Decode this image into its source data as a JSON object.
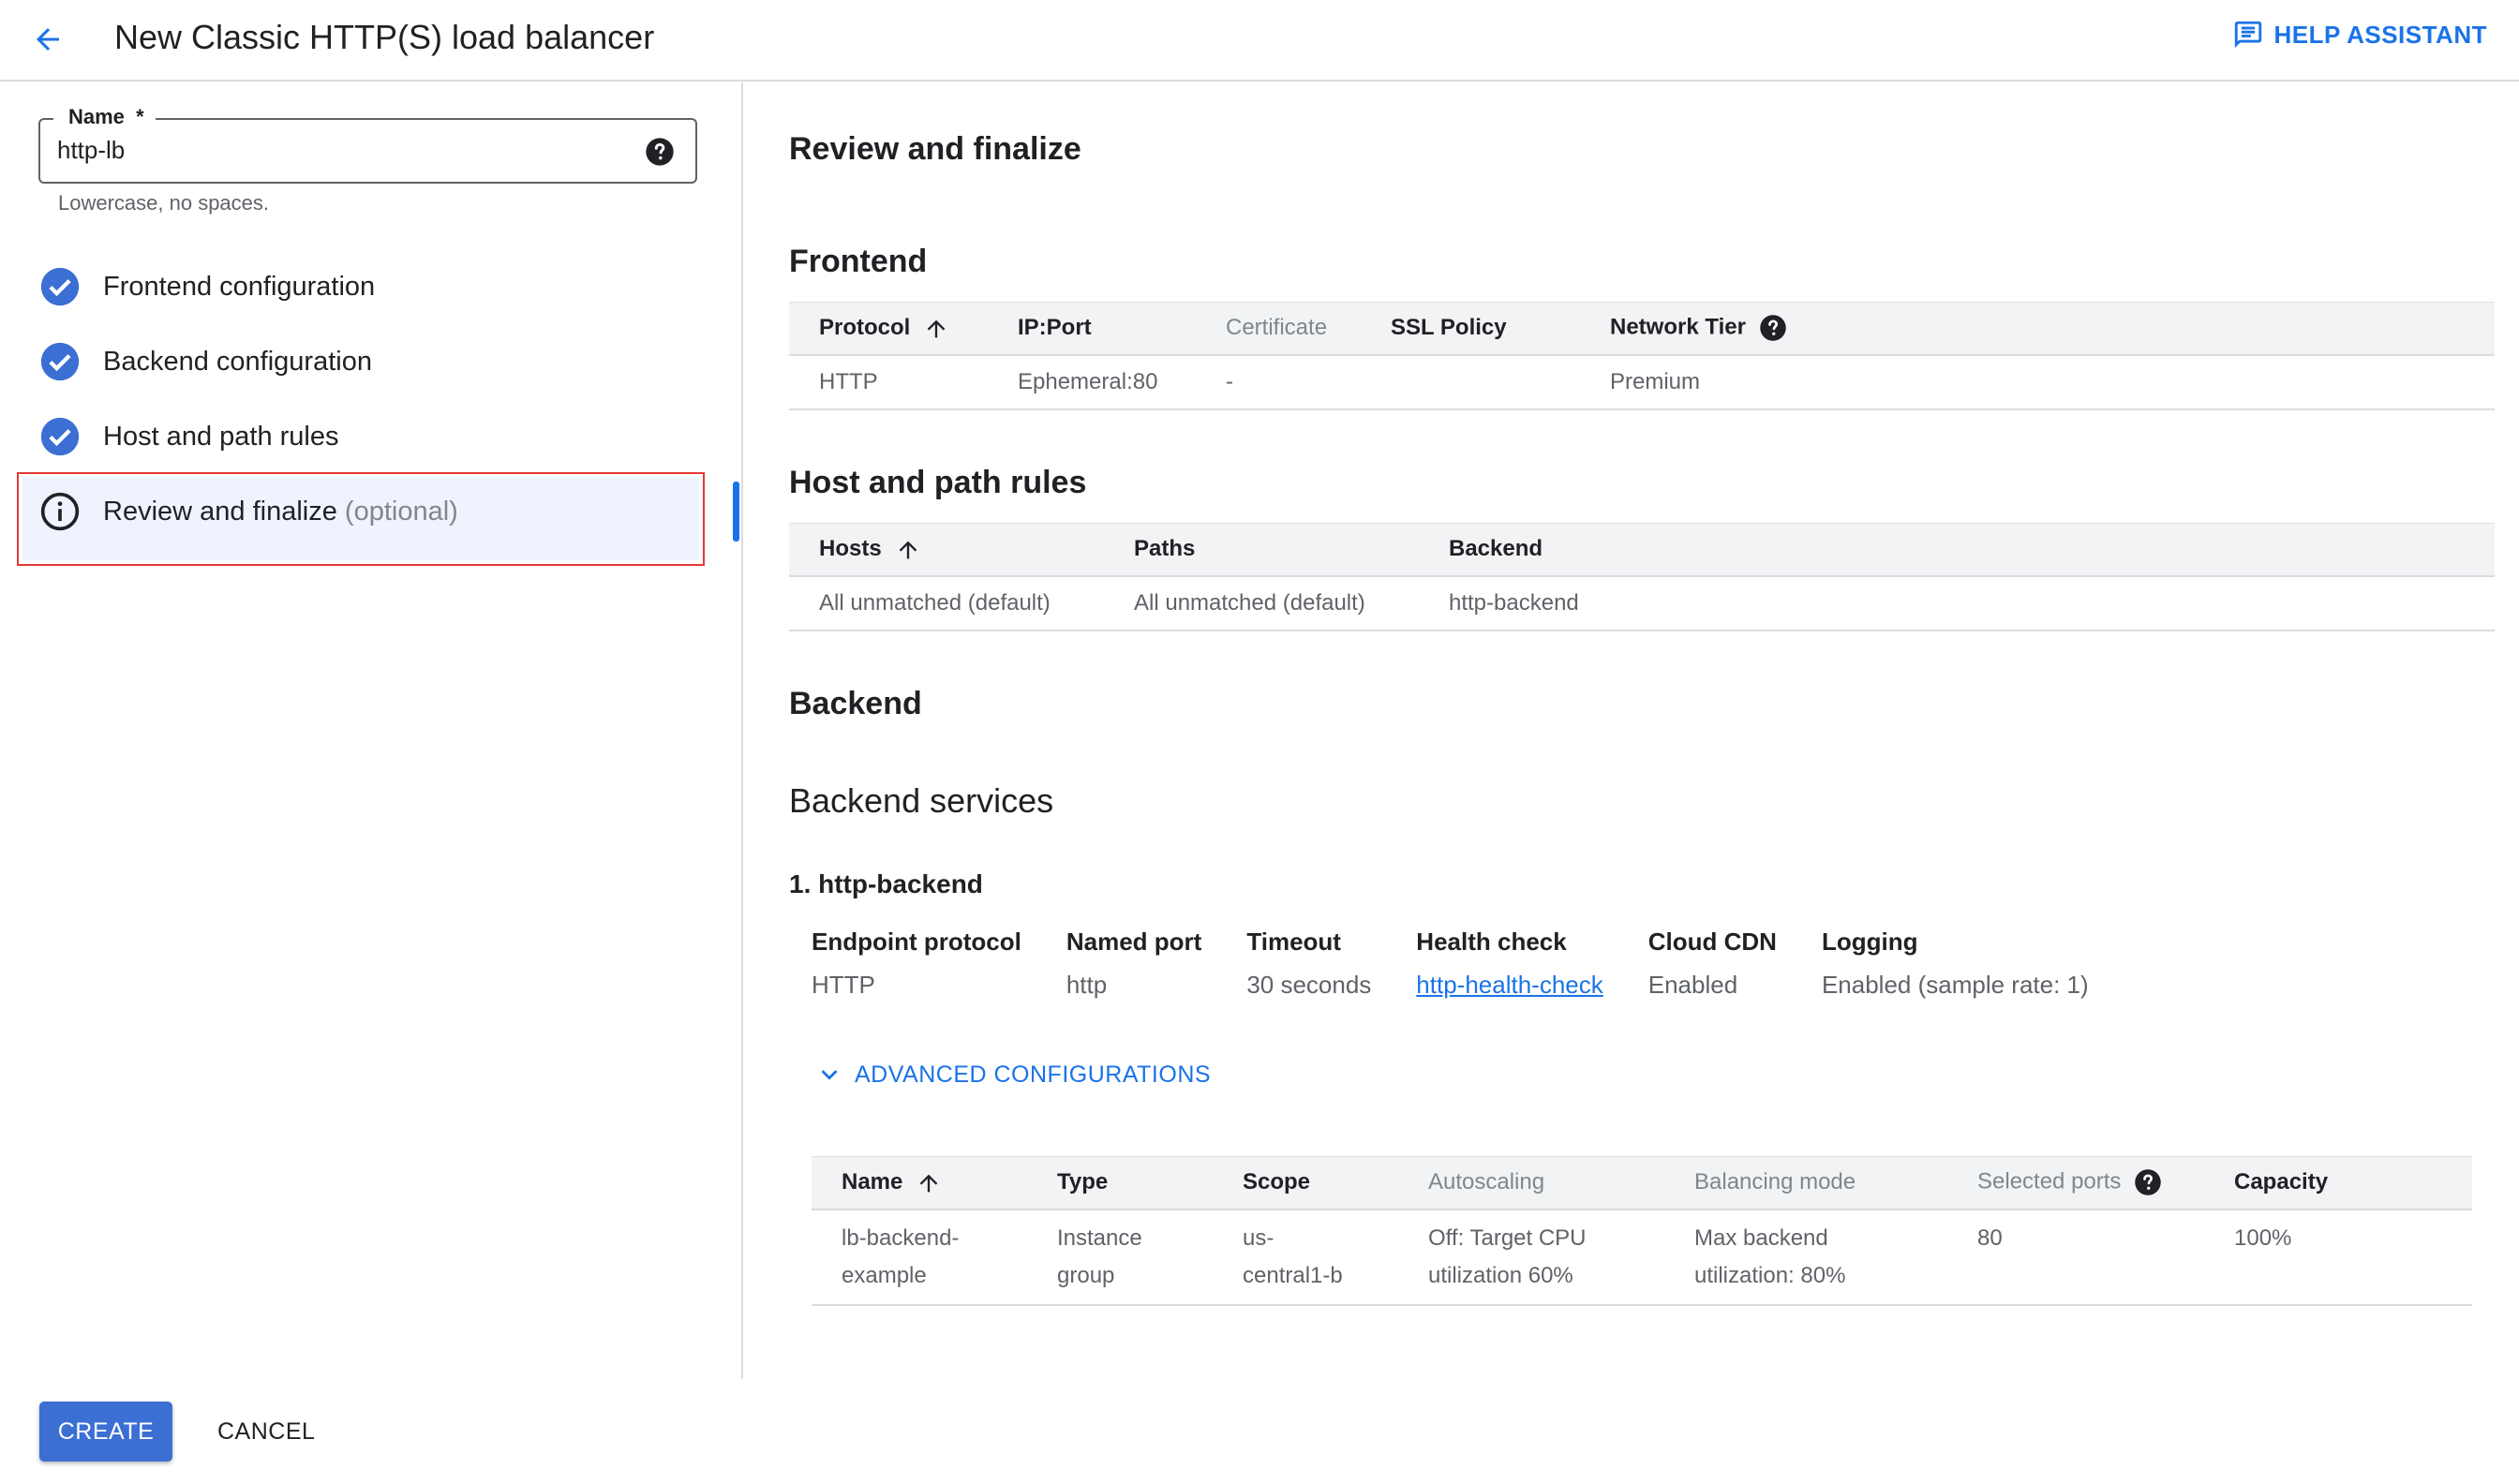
{
  "header": {
    "title": "New Classic HTTP(S) load balancer",
    "help_label": "HELP ASSISTANT"
  },
  "name_field": {
    "label": "Name",
    "required_mark": "*",
    "value": "http-lb",
    "hint": "Lowercase, no spaces."
  },
  "steps": [
    {
      "label": "Frontend configuration",
      "status": "complete"
    },
    {
      "label": "Backend configuration",
      "status": "complete"
    },
    {
      "label": "Host and path rules",
      "status": "complete"
    },
    {
      "label": "Review and finalize",
      "optional": "(optional)",
      "status": "active"
    }
  ],
  "actions": {
    "create": "CREATE",
    "cancel": "CANCEL"
  },
  "review": {
    "title": "Review and finalize",
    "frontend": {
      "title": "Frontend",
      "columns": [
        "Protocol",
        "IP:Port",
        "Certificate",
        "SSL Policy",
        "Network Tier"
      ],
      "rows": [
        [
          "HTTP",
          "Ephemeral:80",
          "-",
          "",
          "Premium"
        ]
      ]
    },
    "host_path": {
      "title": "Host and path rules",
      "columns": [
        "Hosts",
        "Paths",
        "Backend"
      ],
      "rows": [
        [
          "All unmatched (default)",
          "All unmatched (default)",
          "http-backend"
        ]
      ]
    },
    "backend": {
      "title": "Backend",
      "services_title": "Backend services",
      "service": {
        "title": "1. http-backend",
        "props": [
          {
            "key": "Endpoint protocol",
            "value": "HTTP"
          },
          {
            "key": "Named port",
            "value": "http"
          },
          {
            "key": "Timeout",
            "value": "30 seconds"
          },
          {
            "key": "Health check",
            "value": "http-health-check"
          },
          {
            "key": "Cloud CDN",
            "value": "Enabled"
          },
          {
            "key": "Logging",
            "value": "Enabled (sample rate: 1)"
          }
        ]
      },
      "advanced_label": "ADVANCED CONFIGURATIONS",
      "table": {
        "columns": [
          "Name",
          "Type",
          "Scope",
          "Autoscaling",
          "Balancing mode",
          "Selected ports",
          "Capacity"
        ],
        "rows": [
          [
            {
              "l1": "lb-backend-",
              "l2": "example"
            },
            {
              "l1": "Instance",
              "l2": "group"
            },
            {
              "l1": "us-",
              "l2": "central1-b"
            },
            {
              "l1": "Off: Target CPU",
              "l2": "utilization 60%"
            },
            {
              "l1": "Max backend",
              "l2": "utilization: 80%"
            },
            {
              "l1": "80",
              "l2": ""
            },
            {
              "l1": "100%",
              "l2": ""
            }
          ]
        ]
      }
    }
  },
  "colors": {
    "accent": "#1a73e8",
    "create_button": "#3b6fd4",
    "highlight_border": "#e53935",
    "active_step_bg": "#eef3fd"
  }
}
